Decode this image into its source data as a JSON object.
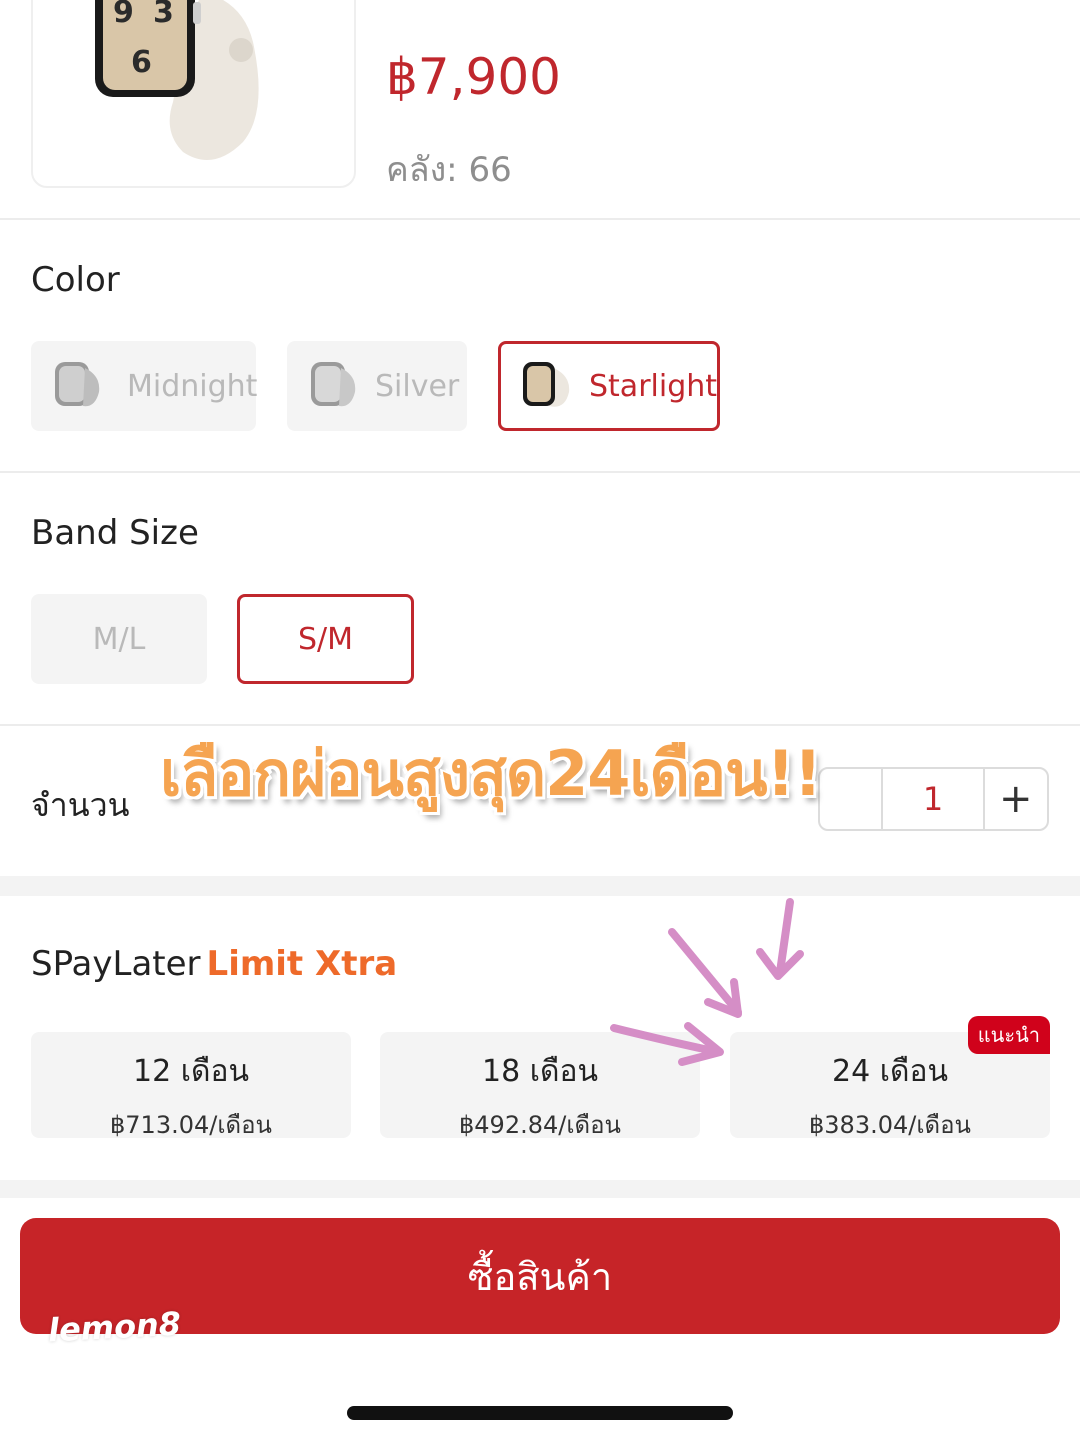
{
  "product": {
    "price": "฿7,900",
    "stock": "คลัง: 66"
  },
  "color": {
    "title": "Color",
    "options": [
      {
        "label": "Midnight",
        "selected": false
      },
      {
        "label": "Silver",
        "selected": false
      },
      {
        "label": "Starlight",
        "selected": true
      }
    ]
  },
  "band_size": {
    "title": "Band Size",
    "options": [
      {
        "label": "M/L",
        "selected": false
      },
      {
        "label": "S/M",
        "selected": true
      }
    ]
  },
  "quantity": {
    "label": "จำนวน",
    "value": "1",
    "plus": "+"
  },
  "promo_overlay": "เลือกผ่อนสูงสุด24เดือน!!",
  "spaylater": {
    "title": "SPayLater",
    "highlight": "Limit Xtra",
    "plans": [
      {
        "months": "12 เดือน",
        "monthly": "฿713.04/เดือน"
      },
      {
        "months": "18 เดือน",
        "monthly": "฿492.84/เดือน"
      },
      {
        "months": "24 เดือน",
        "monthly": "฿383.04/เดือน",
        "badge": "แนะนำ"
      }
    ]
  },
  "buy_button": "ซื้อสินค้า",
  "watermark": "lemon8",
  "colors": {
    "accent": "#c0272d",
    "promo_text": "#f5a451",
    "xtra": "#ee6a2a",
    "arrows": "#d58ec6"
  }
}
